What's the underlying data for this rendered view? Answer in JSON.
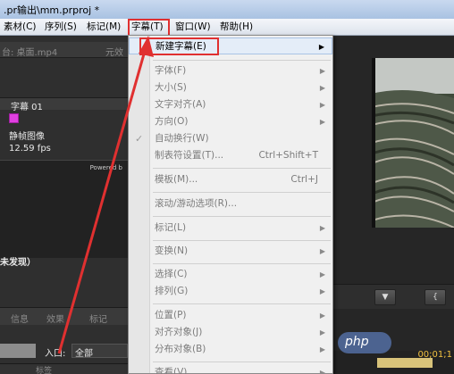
{
  "window": {
    "title": ".pr输出\\mm.prproj *"
  },
  "menubar": {
    "items": [
      "素材(C)",
      "序列(S)",
      "标记(M)",
      "字幕(T)",
      "窗口(W)",
      "帮助(H)"
    ]
  },
  "left_panel": {
    "source_tab": "台: 桌面.mp4",
    "source_tab2": "元效",
    "title_name": "字幕 01",
    "type_label": "静帧图像",
    "fps": "12.59 fps",
    "powered_text": "Powered b",
    "status_text": "未发现）",
    "tabs": [
      "信息",
      "效果",
      "标记"
    ],
    "in_label": "入口:",
    "in_value": "全部",
    "col_label": "标签"
  },
  "dropdown": {
    "items": [
      {
        "label": "新建字幕(E)",
        "shortcut": "",
        "submenu": true,
        "active": true
      },
      {
        "label": "字体(F)",
        "shortcut": "",
        "submenu": true,
        "active": false
      },
      {
        "label": "大小(S)",
        "shortcut": "",
        "submenu": true,
        "active": false
      },
      {
        "label": "文字对齐(A)",
        "shortcut": "",
        "submenu": true,
        "active": false
      },
      {
        "label": "方向(O)",
        "shortcut": "",
        "submenu": true,
        "active": false
      },
      {
        "label": "自动换行(W)",
        "shortcut": "",
        "submenu": false,
        "active": false,
        "checked": true
      },
      {
        "label": "制表符设置(T)...",
        "shortcut": "Ctrl+Shift+T",
        "submenu": false,
        "active": false
      },
      {
        "label": "模板(M)...",
        "shortcut": "Ctrl+J",
        "submenu": false,
        "active": false
      },
      {
        "label": "滚动/游动选项(R)...",
        "shortcut": "",
        "submenu": false,
        "active": false
      },
      {
        "label": "标记(L)",
        "shortcut": "",
        "submenu": true,
        "active": false
      },
      {
        "label": "变换(N)",
        "shortcut": "",
        "submenu": true,
        "active": false
      },
      {
        "label": "选择(C)",
        "shortcut": "",
        "submenu": true,
        "active": false
      },
      {
        "label": "排列(G)",
        "shortcut": "",
        "submenu": true,
        "active": false
      },
      {
        "label": "位置(P)",
        "shortcut": "",
        "submenu": true,
        "active": false
      },
      {
        "label": "对齐对象(J)",
        "shortcut": "",
        "submenu": true,
        "active": false
      },
      {
        "label": "分布对象(B)",
        "shortcut": "",
        "submenu": true,
        "active": false
      },
      {
        "label": "查看(V)",
        "shortcut": "",
        "submenu": true,
        "active": false
      }
    ]
  },
  "timeline": {
    "timecode": "00;01;1"
  },
  "watermark": "php",
  "colors": {
    "highlight_border": "#e03030",
    "menu_bg": "#f0f0f0",
    "swatch": "#e040e0"
  }
}
